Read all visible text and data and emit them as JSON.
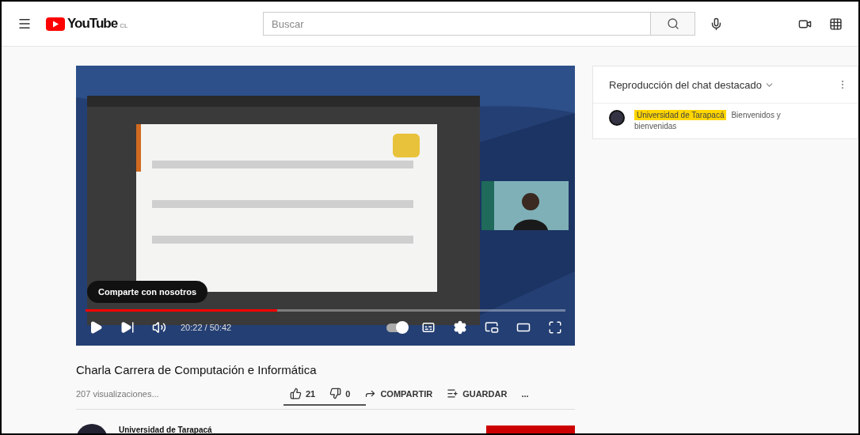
{
  "header": {
    "logo": "YouTube",
    "country": "CL",
    "search": {
      "placeholder": "Buscar"
    }
  },
  "player": {
    "tooltip": "Comparte con nosotros",
    "time": "20:22 / 50:42",
    "progress": {
      "level": 0.4
    },
    "autoplay": {
      "on": true
    }
  },
  "chat": {
    "title": "Reproducción del chat destacado",
    "messages": [
      {
        "author": "Universidad de Tarapacá",
        "text": "Bienvenidos y bienvenidas"
      }
    ]
  },
  "video": {
    "title": "Charla Carrera de Computación e Informática",
    "views": "207 visualizaciones...",
    "actions": [
      {
        "kind": "like",
        "label": "21"
      },
      {
        "kind": "dislike",
        "label": "0"
      },
      {
        "kind": "share",
        "label": "COMPARTIR"
      },
      {
        "kind": "save",
        "label": "GUARDAR"
      },
      {
        "kind": "more",
        "label": "..."
      }
    ],
    "sentiment": {
      "level": 1
    }
  },
  "channel": {
    "name": "Universidad de Tarapacá"
  }
}
